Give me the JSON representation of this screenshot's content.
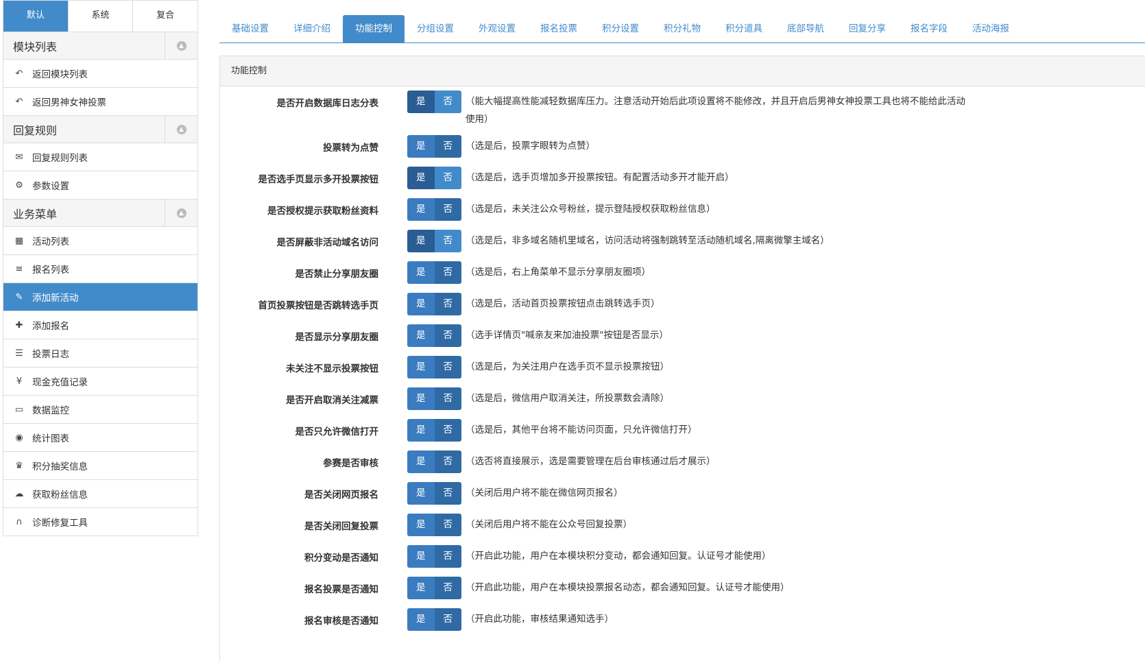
{
  "sidebar": {
    "tabs": [
      {
        "label": "默认",
        "active": true
      },
      {
        "label": "系统",
        "active": false
      },
      {
        "label": "复合",
        "active": false
      }
    ],
    "groups": [
      {
        "title": "模块列表",
        "items": [
          {
            "label": "返回模块列表",
            "icon": "reply-icon"
          },
          {
            "label": "返回男神女神投票",
            "icon": "reply-icon"
          }
        ]
      },
      {
        "title": "回复规则",
        "items": [
          {
            "label": "回复规则列表",
            "icon": "comments-icon"
          },
          {
            "label": "参数设置",
            "icon": "gear-icon"
          }
        ]
      },
      {
        "title": "业务菜单",
        "items": [
          {
            "label": "活动列表",
            "icon": "calendar-icon"
          },
          {
            "label": "报名列表",
            "icon": "list-icon"
          },
          {
            "label": "添加新活动",
            "icon": "edit-icon",
            "active": true
          },
          {
            "label": "添加报名",
            "icon": "plus-icon"
          },
          {
            "label": "投票日志",
            "icon": "database-icon"
          },
          {
            "label": "现金充值记录",
            "icon": "yen-icon"
          },
          {
            "label": "数据监控",
            "icon": "laptop-icon"
          },
          {
            "label": "统计图表",
            "icon": "eye-icon"
          },
          {
            "label": "积分抽奖信息",
            "icon": "trophy-icon"
          },
          {
            "label": "获取粉丝信息",
            "icon": "cloud-download-icon"
          },
          {
            "label": "诊断修复工具",
            "icon": "headphones-icon"
          }
        ]
      }
    ]
  },
  "topnav": {
    "tabs": [
      {
        "label": "基础设置"
      },
      {
        "label": "详细介绍"
      },
      {
        "label": "功能控制",
        "active": true
      },
      {
        "label": "分组设置"
      },
      {
        "label": "外观设置"
      },
      {
        "label": "报名投票"
      },
      {
        "label": "积分设置"
      },
      {
        "label": "积分礼物"
      },
      {
        "label": "积分道具"
      },
      {
        "label": "底部导航"
      },
      {
        "label": "回复分享"
      },
      {
        "label": "报名字段"
      },
      {
        "label": "活动海报"
      }
    ]
  },
  "panel": {
    "title": "功能控制",
    "yes_label": "是",
    "no_label": "否",
    "rows": [
      {
        "label": "是否开启数据库日志分表",
        "desc": "（能大幅提高性能减轻数据库压力。注意活动开始后此项设置将不能修改，并且开启后男神女神投票工具也将不能给此活动使用）",
        "selected": "yes"
      },
      {
        "label": "投票转为点赞",
        "desc": "（选是后，投票字眼转为点赞）",
        "selected": "no"
      },
      {
        "label": "是否选手页显示多开投票按钮",
        "desc": "（选是后，选手页增加多开投票按钮。有配置活动多开才能开启）",
        "selected": "yes"
      },
      {
        "label": "是否授权提示获取粉丝资料",
        "desc": "（选是后，未关注公众号粉丝，提示登陆授权获取粉丝信息）",
        "selected": "no"
      },
      {
        "label": "是否屏蔽非活动域名访问",
        "desc": "（选是后，非多域名随机里域名，访问活动将强制跳转至活动随机域名,隔离微擎主域名）",
        "selected": "yes"
      },
      {
        "label": "是否禁止分享朋友圈",
        "desc": "（选是后，右上角菜单不显示分享朋友圈项）",
        "selected": "no"
      },
      {
        "label": "首页投票按钮是否跳转选手页",
        "desc": "（选是后，活动首页投票按钮点击跳转选手页）",
        "selected": "no"
      },
      {
        "label": "是否显示分享朋友圈",
        "desc": "（选手详情页\"喊亲友来加油投票\"按钮是否显示）",
        "selected": "no"
      },
      {
        "label": "未关注不显示投票按钮",
        "desc": "（选是后，为关注用户在选手页不显示投票按钮）",
        "selected": "no"
      },
      {
        "label": "是否开启取消关注减票",
        "desc": "（选是后，微信用户取消关注，所投票数会清除）",
        "selected": "no"
      },
      {
        "label": "是否只允许微信打开",
        "desc": "（选是后，其他平台将不能访问页面，只允许微信打开）",
        "selected": "no"
      },
      {
        "label": "参赛是否审核",
        "desc": "（选否将直接展示，选是需要管理在后台审核通过后才展示）",
        "selected": "no"
      },
      {
        "label": "是否关闭网页报名",
        "desc": "（关闭后用户将不能在微信网页报名）",
        "selected": "no"
      },
      {
        "label": "是否关闭回复投票",
        "desc": "（关闭后用户将不能在公众号回复投票）",
        "selected": "no"
      },
      {
        "label": "积分变动是否通知",
        "desc": "（开启此功能，用户在本模块积分变动，都会通知回复。认证号才能使用）",
        "selected": "no"
      },
      {
        "label": "报名投票是否通知",
        "desc": "（开启此功能，用户在本模块投票报名动态，都会通知回复。认证号才能使用）",
        "selected": "no"
      },
      {
        "label": "报名审核是否通知",
        "desc": "（开启此功能，审核结果通知选手）",
        "selected": "no"
      }
    ]
  },
  "colors": {
    "accent": "#428bca"
  }
}
